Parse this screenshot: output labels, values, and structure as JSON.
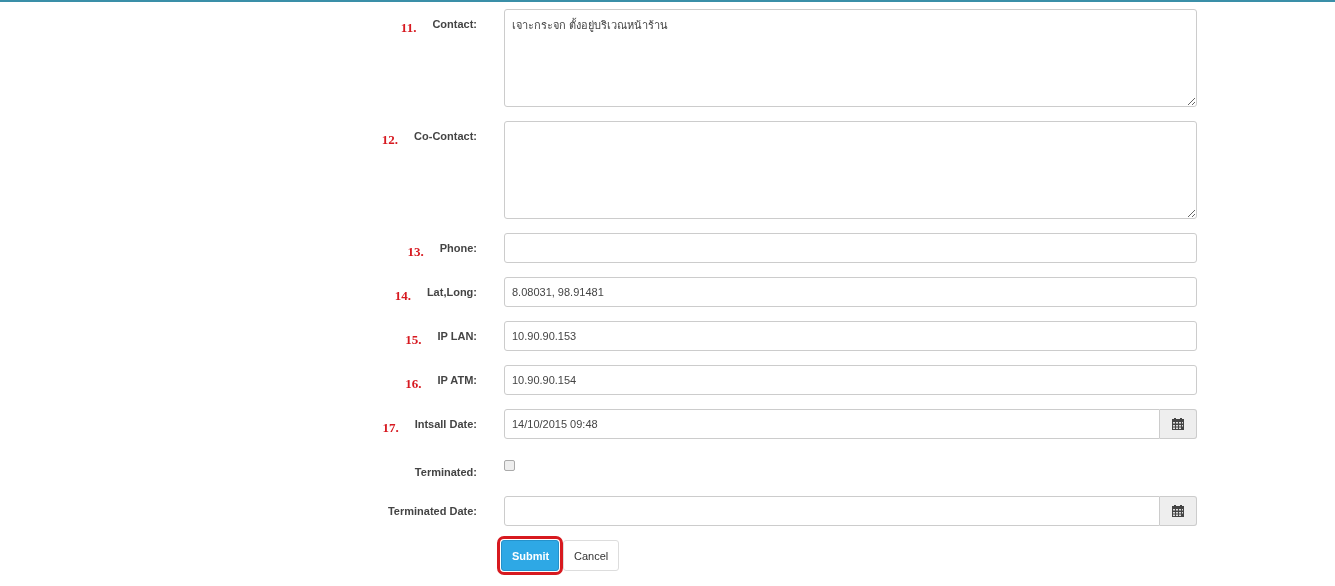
{
  "fields": [
    {
      "number": "11.",
      "label": "Contact:",
      "kind": "textarea",
      "value": "เจาะกระจก ตั้งอยู่บริเวณหน้าร้าน"
    },
    {
      "number": "12.",
      "label": "Co-Contact:",
      "kind": "textarea"
    },
    {
      "number": "13.",
      "label": "Phone:",
      "kind": "text"
    },
    {
      "number": "14.",
      "label": "Lat,Long:",
      "kind": "text",
      "value": "8.08031, 98.91481"
    },
    {
      "number": "15.",
      "label": "IP LAN:",
      "kind": "text",
      "value": "10.90.90.153"
    },
    {
      "number": "16.",
      "label": "IP ATM:",
      "kind": "text",
      "value": "10.90.90.154"
    },
    {
      "number": "17.",
      "label": "Intsall Date:",
      "kind": "date",
      "value": "14/10/2015 09:48"
    },
    {
      "label": "Terminated:",
      "kind": "checkbox",
      "checked": false
    },
    {
      "label": "Terminated Date:",
      "kind": "date"
    }
  ],
  "buttons": [
    {
      "label": "Submit",
      "kind": "primary",
      "highlighted": true
    },
    {
      "label": "Cancel",
      "kind": "default",
      "highlighted": false
    }
  ]
}
